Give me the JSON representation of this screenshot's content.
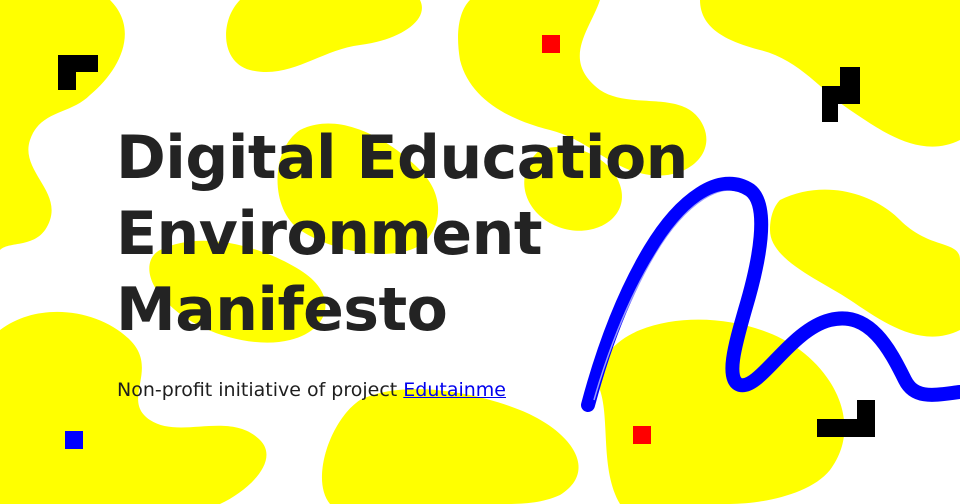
{
  "headline": {
    "line1": "Digital Education",
    "line2": "Environment",
    "line3": "Manifesto"
  },
  "subtitle": {
    "text": "Non-profit initiative of project ",
    "link_text": "Edutainme"
  },
  "colors": {
    "background": "#ffffff",
    "blob": "#ffff00",
    "text": "#232323",
    "link": "#0000ee",
    "accent_red": "#ff0000",
    "accent_blue": "#0000ff",
    "accent_black": "#000000"
  }
}
